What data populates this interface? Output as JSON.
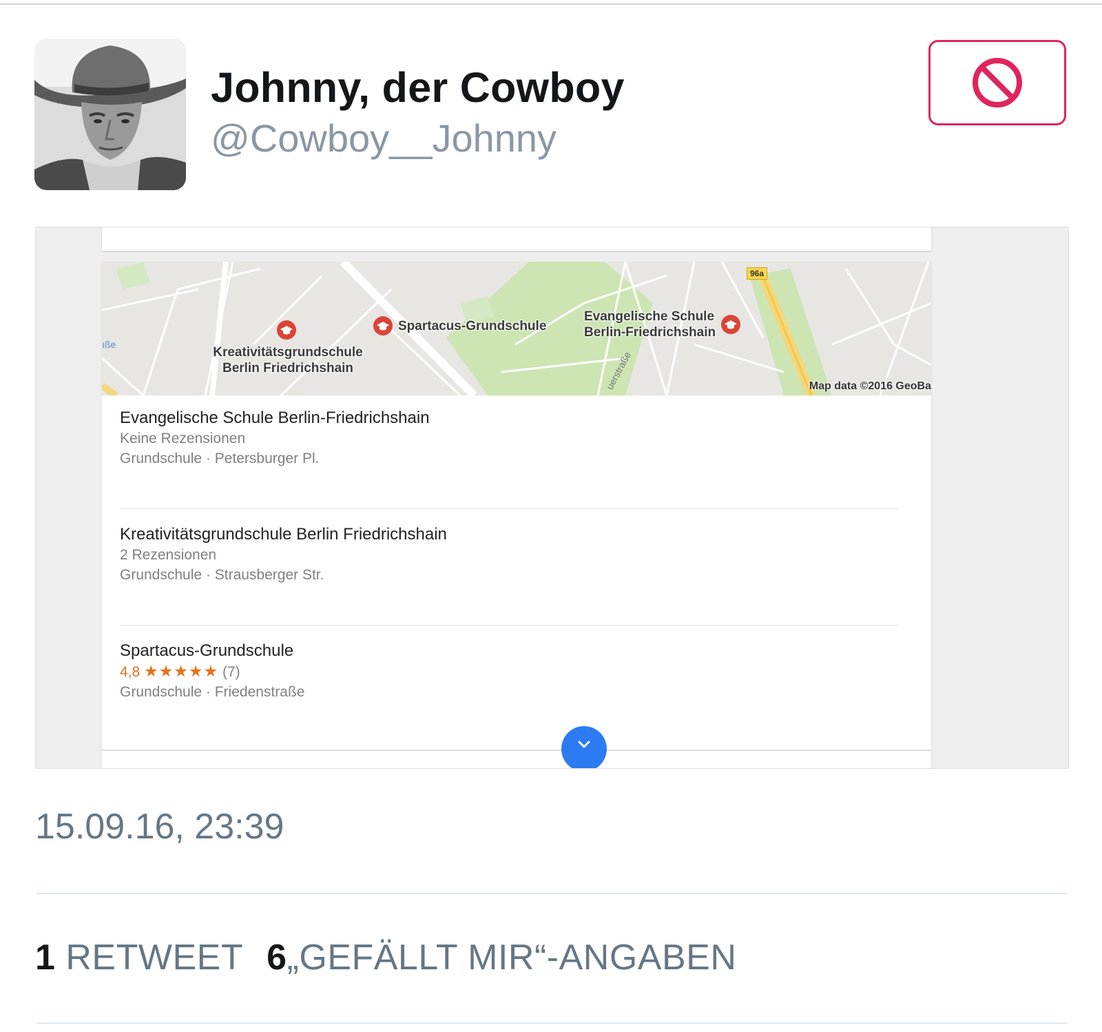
{
  "tweet": {
    "display_name": "Johnny, der Cowboy",
    "handle": "@Cowboy__Johnny",
    "timestamp": "15.09.16, 23:39",
    "retweets": {
      "count": "1",
      "label": "RETWEET"
    },
    "likes": {
      "count": "6",
      "label": "„GEFÄLLT MIR“-ANGABEN"
    },
    "block_icon": "block-icon",
    "colors": {
      "block_accent": "#e0245e",
      "secondary_text": "#657786",
      "handle_text": "#8a97a5",
      "expand_button": "#2c7bf2",
      "rating": "#e7711b"
    }
  },
  "map": {
    "labels": {
      "kreativ": "Kreativitätsgrundschule\nBerlin Friedrichshain",
      "spartacus": "Spartacus-Grundschule",
      "evangelische": "Evangelische Schule\nBerlin-Friedrichshain"
    },
    "attribution": "Map data ©2016 GeoBa",
    "road_label": "uerstraße",
    "edge_label": "ıße",
    "route_badge": "96a",
    "pin_icon": "school-pin-icon"
  },
  "places": [
    {
      "name": "Evangelische Schule Berlin-Friedrichshain",
      "reviews": "Keine Rezensionen",
      "details": "Grundschule · Petersburger Pl."
    },
    {
      "name": "Kreativitätsgrundschule Berlin Friedrichshain",
      "reviews": "2 Rezensionen",
      "details": "Grundschule · Strausberger Str."
    },
    {
      "name": "Spartacus-Grundschule",
      "rating_value": "4,8",
      "rating": 4.8,
      "stars": "★★★★★",
      "rating_count": "(7)",
      "details": "Grundschule · Friedenstraße"
    }
  ],
  "expand_icon": "chevron-down-icon"
}
